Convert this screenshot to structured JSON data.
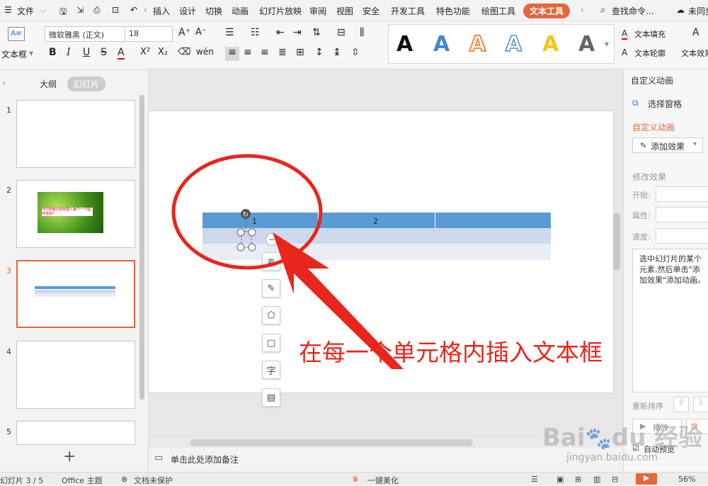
{
  "menu": {
    "file_label": "文件",
    "tabs": [
      "插入",
      "设计",
      "切换",
      "动画",
      "幻灯片放映",
      "审阅",
      "视图",
      "安全",
      "开发工具",
      "特色功能",
      "绘图工具",
      "文本工具"
    ],
    "search_label": "查找命令...",
    "sync_label": "未同步"
  },
  "ribbon": {
    "textbox_label": "文本框",
    "font_name": "微软雅黑 (正文)",
    "font_size": "18",
    "fill_label": "文本填充",
    "outline_label": "文本轮廓",
    "effect_label": "文本效果"
  },
  "left_panel": {
    "tab_outline": "大纲",
    "tab_slides": "幻灯片",
    "slide_numbers": [
      "1",
      "2",
      "3",
      "4",
      "5"
    ],
    "slide2_text": "PPT表格中如何插入每个一个圆环选单?",
    "add_slide_symbol": "+"
  },
  "slide": {
    "table_header": [
      "1",
      "2",
      ""
    ],
    "annotation_text": "在每一个单元格内插入文本框",
    "annotation_color": "#e8261c",
    "table_header_color": "#5b9bd5"
  },
  "notes": {
    "placeholder": "单击此处添加备注"
  },
  "right_panel": {
    "dropdown_title": "自定义动画",
    "select_pane": "选择窗格",
    "section_title": "自定义动画",
    "add_effect": "添加效果",
    "modify_title": "修改效果",
    "start_label": "开始:",
    "property_label": "属性:",
    "speed_label": "速度:",
    "hint_text": "选中幻灯片的某个元素,然后单击\"添加效果\"添加动画。",
    "reorder_label": "重新排序",
    "play_label": "播放",
    "auto_preview": "自动预览",
    "accent_color": "#e4663a"
  },
  "status": {
    "slide_info": "幻灯片 3 / 5",
    "theme": "Office 主题",
    "protect": "文档未保护",
    "beautify": "一键美化",
    "zoom": "56%"
  },
  "watermark": {
    "brand": "Baidu经验",
    "url": "jingyan.baidu.com"
  }
}
